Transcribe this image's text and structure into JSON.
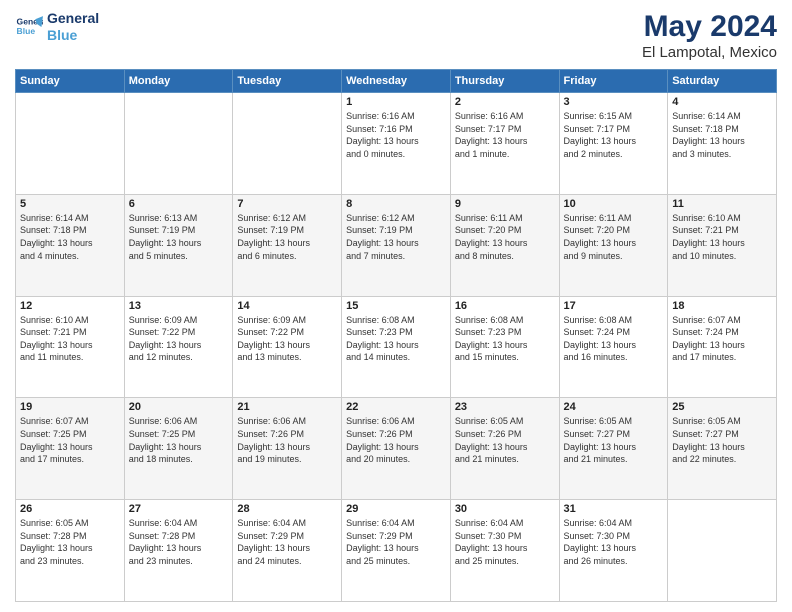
{
  "logo": {
    "line1": "General",
    "line2": "Blue"
  },
  "title": "May 2024",
  "location": "El Lampotal, Mexico",
  "weekdays": [
    "Sunday",
    "Monday",
    "Tuesday",
    "Wednesday",
    "Thursday",
    "Friday",
    "Saturday"
  ],
  "weeks": [
    [
      {
        "day": "",
        "info": ""
      },
      {
        "day": "",
        "info": ""
      },
      {
        "day": "",
        "info": ""
      },
      {
        "day": "1",
        "info": "Sunrise: 6:16 AM\nSunset: 7:16 PM\nDaylight: 13 hours\nand 0 minutes."
      },
      {
        "day": "2",
        "info": "Sunrise: 6:16 AM\nSunset: 7:17 PM\nDaylight: 13 hours\nand 1 minute."
      },
      {
        "day": "3",
        "info": "Sunrise: 6:15 AM\nSunset: 7:17 PM\nDaylight: 13 hours\nand 2 minutes."
      },
      {
        "day": "4",
        "info": "Sunrise: 6:14 AM\nSunset: 7:18 PM\nDaylight: 13 hours\nand 3 minutes."
      }
    ],
    [
      {
        "day": "5",
        "info": "Sunrise: 6:14 AM\nSunset: 7:18 PM\nDaylight: 13 hours\nand 4 minutes."
      },
      {
        "day": "6",
        "info": "Sunrise: 6:13 AM\nSunset: 7:19 PM\nDaylight: 13 hours\nand 5 minutes."
      },
      {
        "day": "7",
        "info": "Sunrise: 6:12 AM\nSunset: 7:19 PM\nDaylight: 13 hours\nand 6 minutes."
      },
      {
        "day": "8",
        "info": "Sunrise: 6:12 AM\nSunset: 7:19 PM\nDaylight: 13 hours\nand 7 minutes."
      },
      {
        "day": "9",
        "info": "Sunrise: 6:11 AM\nSunset: 7:20 PM\nDaylight: 13 hours\nand 8 minutes."
      },
      {
        "day": "10",
        "info": "Sunrise: 6:11 AM\nSunset: 7:20 PM\nDaylight: 13 hours\nand 9 minutes."
      },
      {
        "day": "11",
        "info": "Sunrise: 6:10 AM\nSunset: 7:21 PM\nDaylight: 13 hours\nand 10 minutes."
      }
    ],
    [
      {
        "day": "12",
        "info": "Sunrise: 6:10 AM\nSunset: 7:21 PM\nDaylight: 13 hours\nand 11 minutes."
      },
      {
        "day": "13",
        "info": "Sunrise: 6:09 AM\nSunset: 7:22 PM\nDaylight: 13 hours\nand 12 minutes."
      },
      {
        "day": "14",
        "info": "Sunrise: 6:09 AM\nSunset: 7:22 PM\nDaylight: 13 hours\nand 13 minutes."
      },
      {
        "day": "15",
        "info": "Sunrise: 6:08 AM\nSunset: 7:23 PM\nDaylight: 13 hours\nand 14 minutes."
      },
      {
        "day": "16",
        "info": "Sunrise: 6:08 AM\nSunset: 7:23 PM\nDaylight: 13 hours\nand 15 minutes."
      },
      {
        "day": "17",
        "info": "Sunrise: 6:08 AM\nSunset: 7:24 PM\nDaylight: 13 hours\nand 16 minutes."
      },
      {
        "day": "18",
        "info": "Sunrise: 6:07 AM\nSunset: 7:24 PM\nDaylight: 13 hours\nand 17 minutes."
      }
    ],
    [
      {
        "day": "19",
        "info": "Sunrise: 6:07 AM\nSunset: 7:25 PM\nDaylight: 13 hours\nand 17 minutes."
      },
      {
        "day": "20",
        "info": "Sunrise: 6:06 AM\nSunset: 7:25 PM\nDaylight: 13 hours\nand 18 minutes."
      },
      {
        "day": "21",
        "info": "Sunrise: 6:06 AM\nSunset: 7:26 PM\nDaylight: 13 hours\nand 19 minutes."
      },
      {
        "day": "22",
        "info": "Sunrise: 6:06 AM\nSunset: 7:26 PM\nDaylight: 13 hours\nand 20 minutes."
      },
      {
        "day": "23",
        "info": "Sunrise: 6:05 AM\nSunset: 7:26 PM\nDaylight: 13 hours\nand 21 minutes."
      },
      {
        "day": "24",
        "info": "Sunrise: 6:05 AM\nSunset: 7:27 PM\nDaylight: 13 hours\nand 21 minutes."
      },
      {
        "day": "25",
        "info": "Sunrise: 6:05 AM\nSunset: 7:27 PM\nDaylight: 13 hours\nand 22 minutes."
      }
    ],
    [
      {
        "day": "26",
        "info": "Sunrise: 6:05 AM\nSunset: 7:28 PM\nDaylight: 13 hours\nand 23 minutes."
      },
      {
        "day": "27",
        "info": "Sunrise: 6:04 AM\nSunset: 7:28 PM\nDaylight: 13 hours\nand 23 minutes."
      },
      {
        "day": "28",
        "info": "Sunrise: 6:04 AM\nSunset: 7:29 PM\nDaylight: 13 hours\nand 24 minutes."
      },
      {
        "day": "29",
        "info": "Sunrise: 6:04 AM\nSunset: 7:29 PM\nDaylight: 13 hours\nand 25 minutes."
      },
      {
        "day": "30",
        "info": "Sunrise: 6:04 AM\nSunset: 7:30 PM\nDaylight: 13 hours\nand 25 minutes."
      },
      {
        "day": "31",
        "info": "Sunrise: 6:04 AM\nSunset: 7:30 PM\nDaylight: 13 hours\nand 26 minutes."
      },
      {
        "day": "",
        "info": ""
      }
    ]
  ]
}
